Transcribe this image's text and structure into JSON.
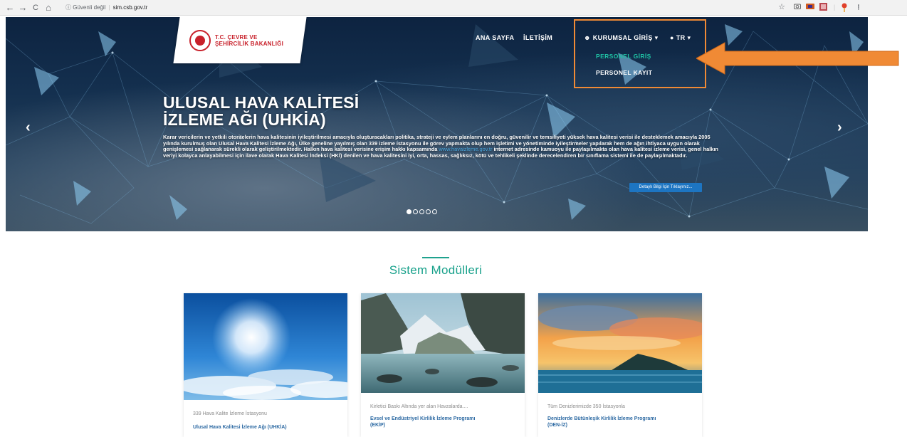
{
  "browser": {
    "back": "←",
    "forward": "→",
    "reload": "C",
    "home": "⌂",
    "security": "ⓘ Güvenli değil",
    "url": "sim.csb.gov.tr",
    "star": "☆"
  },
  "header": {
    "logo_line1": "T.C. ÇEVRE VE",
    "logo_line2": "ŞEHİRCİLİK BAKANLIĞI",
    "nav_home": "ANA SAYFA",
    "nav_contact": "İLETİŞİM",
    "nav_corporate": "KURUMSAL GİRİŞ",
    "nav_lang": "TR",
    "dropdown": {
      "staff_login": "PERSONEL GİRİŞ",
      "staff_register": "PERSONEL KAYIT"
    }
  },
  "hero": {
    "title_line1": "ULUSAL HAVA KALİTESİ",
    "title_line2": "İZLEME AĞI (UHKİA)",
    "desc_part1": "Karar vericilerin ve yetkili otoritelerin hava kalitesinin iyileştirilmesi amacıyla oluşturacakları politika, strateji ve eylem planlarını en doğru, güvenilir ve temsiliyeti yüksek hava kalitesi verisi ile desteklemek amacıyla 2005 yılında kurulmuş olan Ulusal Hava Kalitesi İzleme Ağı, Ülke geneline yayılmış olan 339 izleme istasyonu ile görev yapmakta olup hem işletimi ve yönetiminde iyileştirmeler yapılarak hem de ağın ihtiyaca uygun olarak genişlemesi sağlanarak sürekli olarak geliştirilmektedir. Halkın hava kalitesi verisine erişim hakkı kapsamında ",
    "desc_link": "www.havaizleme.gov.tr",
    "desc_part2": " internet adresinde kamuoyu ile paylaşılmakta olan hava kalitesi izleme verisi, genel halkın veriyi kolayca anlayabilmesi için ilave olarak Hava Kalitesi İndeksi (HKİ) denilen ve hava kalitesini iyi, orta, hassas, sağlıksız, kötü ve tehlikeli şeklinde derecelendiren bir sınıflama sistemi ile de paylaşılmaktadır.",
    "detail_button": "Detaylı Bilgi İçin Tıklayınız...",
    "prev": "‹",
    "next": "›",
    "slide_count": 5,
    "active_slide": 1
  },
  "modules": {
    "title": "Sistem Modülleri",
    "cards": [
      {
        "subtitle": "339 Hava Kalite İzleme İstasyonu",
        "title": "Ulusal Hava Kalitesi İzleme Ağı (UHKİA)",
        "title2": ""
      },
      {
        "subtitle": "Kirletici Baskı Altında yer alan Havzalarda....",
        "title": "Evsel ve Endüstriyel Kirlilik İzleme Programı",
        "title2": "(EKİP)"
      },
      {
        "subtitle": "Tüm Denizlerimizde 350 İstasyonla",
        "title": "Denizlerde Bütünleşik Kirlilik İzleme Programı",
        "title2": "(DEN-İZ)"
      }
    ]
  },
  "colors": {
    "accent_teal": "#19a18b",
    "highlight_orange": "#f08a35",
    "brand_red": "#c8202a",
    "link_blue": "#2d6aa3"
  }
}
